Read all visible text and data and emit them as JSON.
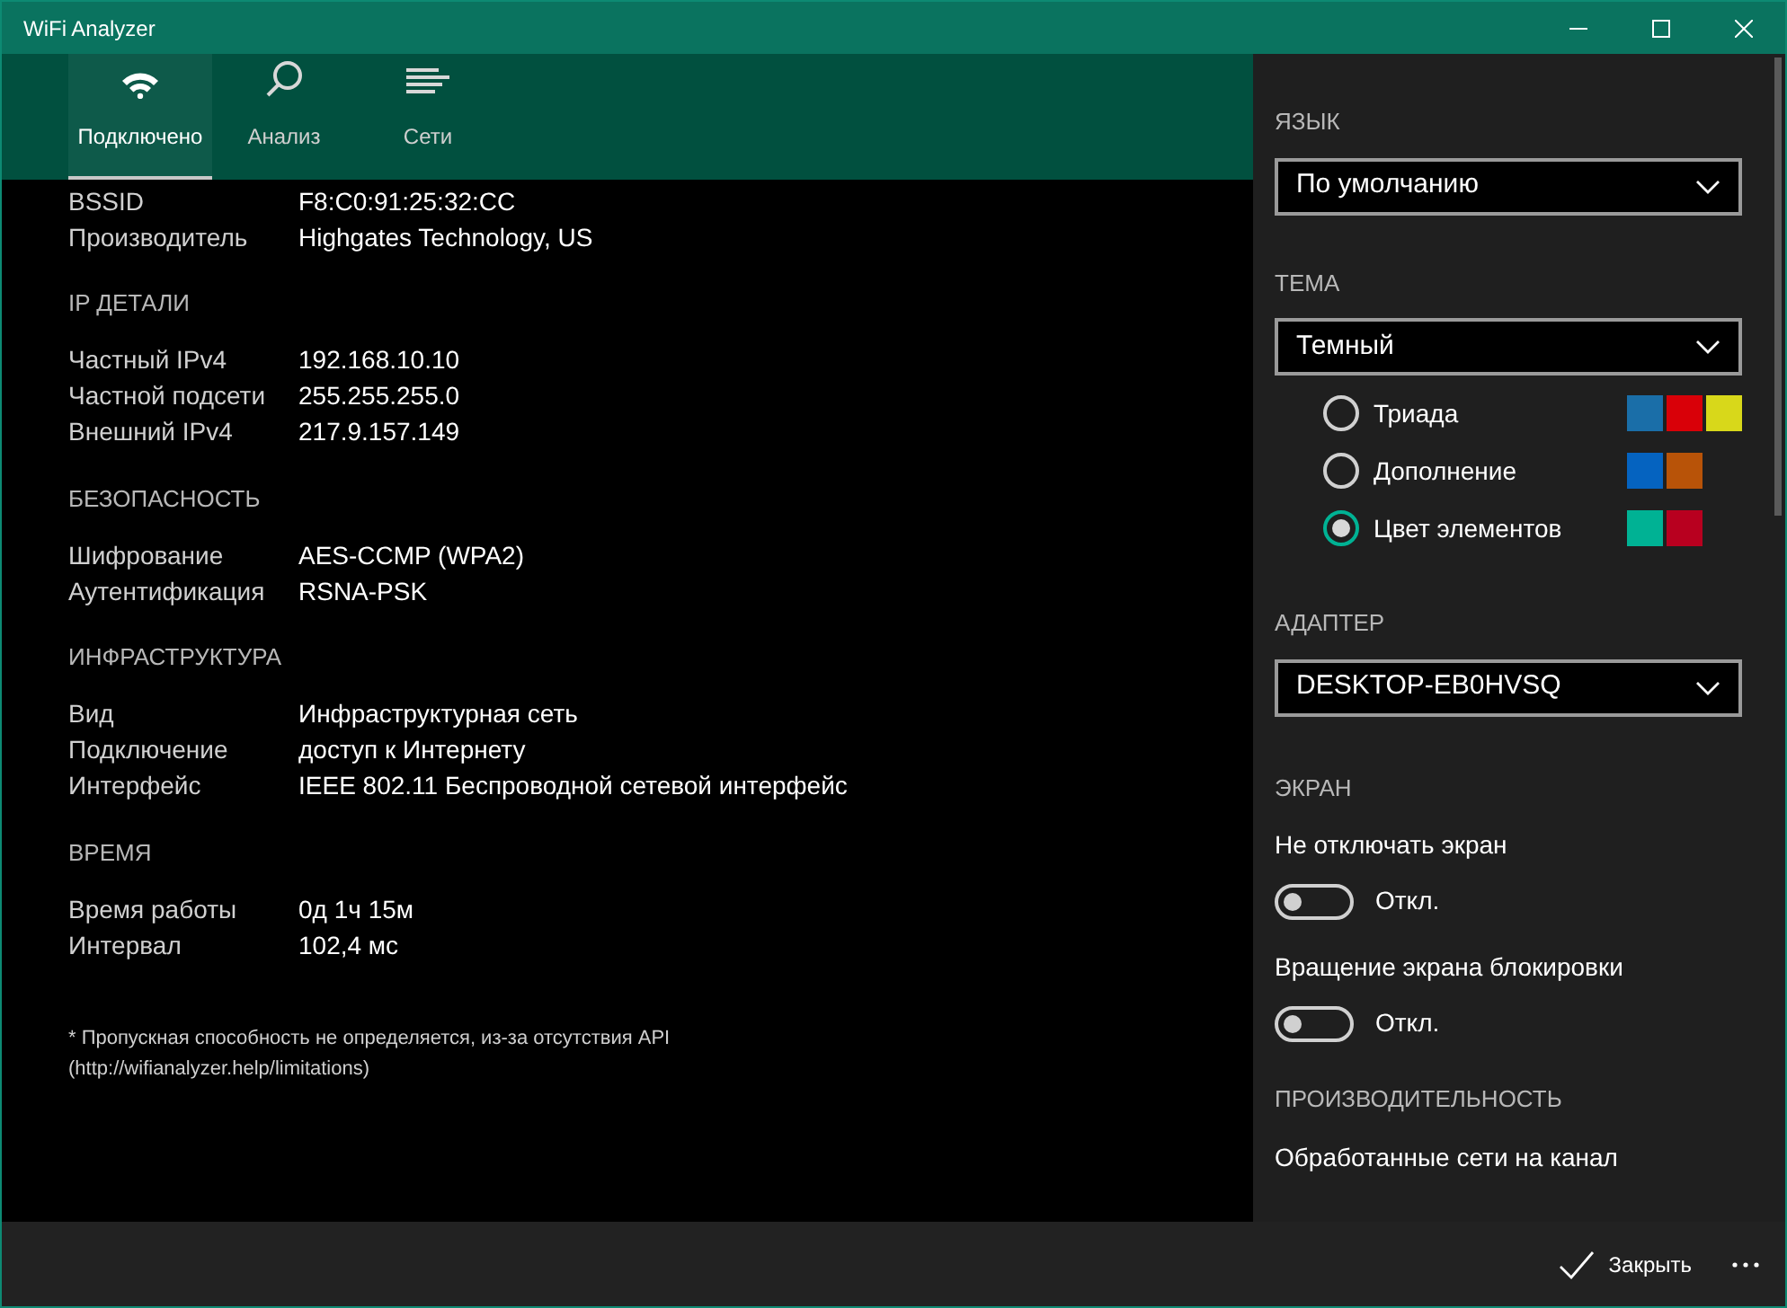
{
  "window": {
    "title": "WiFi Analyzer"
  },
  "tabs": [
    {
      "label": "Подключено",
      "selected": true,
      "kind": "wifi"
    },
    {
      "label": "Анализ",
      "selected": false,
      "kind": "search"
    },
    {
      "label": "Сети",
      "selected": false,
      "kind": "list"
    }
  ],
  "sections": [
    {
      "rows": [
        {
          "label": "BSSID",
          "value": "F8:C0:91:25:32:CC"
        },
        {
          "label": "Производитель",
          "value": "Highgates Technology, US"
        }
      ]
    },
    {
      "heading": "IP ДЕТАЛИ",
      "rows": [
        {
          "label": "Частный IPv4",
          "value": "192.168.10.10"
        },
        {
          "label": "Частной подсети",
          "value": "255.255.255.0"
        },
        {
          "label": "Внешний IPv4",
          "value": "217.9.157.149"
        }
      ]
    },
    {
      "heading": "БЕЗОПАСНОСТЬ",
      "rows": [
        {
          "label": "Шифрование",
          "value": "AES-CCMP (WPA2)"
        },
        {
          "label": "Аутентификация",
          "value": "RSNA-PSK"
        }
      ]
    },
    {
      "heading": "ИНФРАСТРУКТУРА",
      "rows": [
        {
          "label": "Вид",
          "value": "Инфраструктурная сеть"
        },
        {
          "label": "Подключение",
          "value": "доступ к Интернету"
        },
        {
          "label": "Интерфейс",
          "value": "IEEE 802.11 Беспроводной сетевой интерфейс"
        }
      ]
    },
    {
      "heading": "ВРЕМЯ",
      "rows": [
        {
          "label": "Время работы",
          "value": "0д 1ч 15м"
        },
        {
          "label": "Интервал",
          "value": "102,4 мс"
        }
      ]
    }
  ],
  "footnote": [
    "* Пропускная способность не определяется, из-за отсутствия API",
    "(http://wifianalyzer.help/limitations)"
  ],
  "settings": {
    "language": {
      "heading": "ЯЗЫК",
      "value": "По умолчанию"
    },
    "theme": {
      "heading": "ТЕМА",
      "value": "Темный",
      "schemes": [
        {
          "label": "Триада",
          "selected": false,
          "swatches": [
            {
              "color": "#1a6ea8"
            },
            {
              "color": "#d90008"
            },
            {
              "color": "#d8d81a"
            }
          ]
        },
        {
          "label": "Дополнение",
          "selected": false,
          "swatches": [
            {
              "color": "#0563c0"
            },
            {
              "color": "#b85308"
            }
          ]
        },
        {
          "label": "Цвет элементов",
          "selected": true,
          "swatches": [
            {
              "color": "#00b294"
            },
            {
              "color": "#b8001f"
            }
          ]
        }
      ]
    },
    "adapter": {
      "heading": "АДАПТЕР",
      "value": "DESKTOP-EB0HVSQ"
    },
    "screen": {
      "heading": "ЭКРАН",
      "toggles": [
        {
          "label": "Не отключать экран",
          "on": false,
          "state": "Откл."
        },
        {
          "label": "Вращение экрана блокировки",
          "on": false,
          "state": "Откл."
        }
      ]
    },
    "performance": {
      "heading": "ПРОИЗВОДИТЕЛЬНОСТЬ",
      "item": "Обработанные сети на канал"
    }
  },
  "bottom_bar": {
    "close_label": "Закрыть"
  }
}
